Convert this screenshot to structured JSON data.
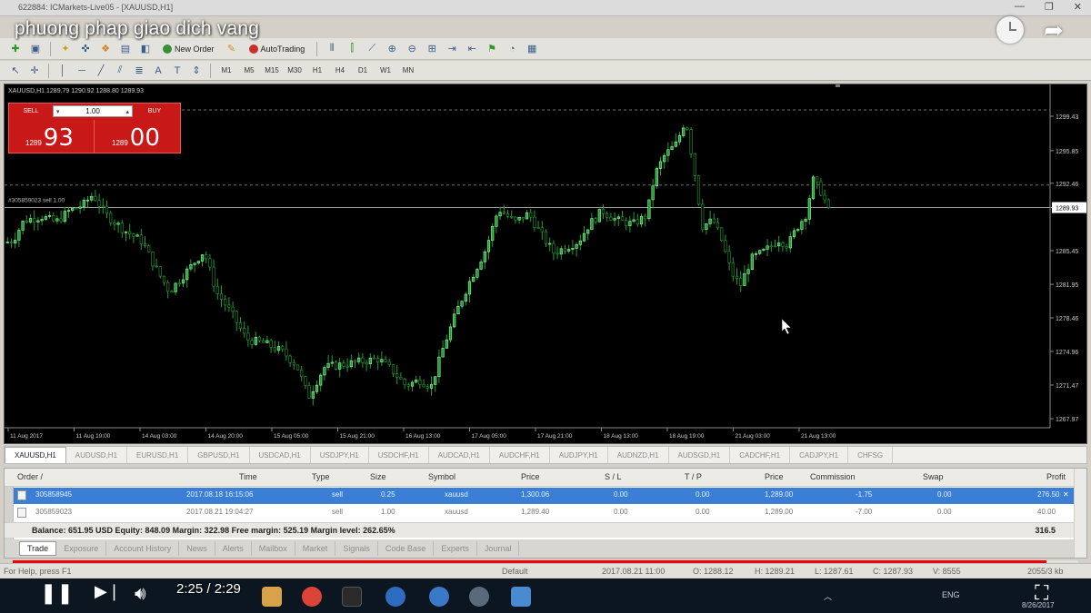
{
  "window": {
    "title": "622884: ICMarkets-Live05 - [XAUUSD,H1]",
    "controls": [
      "—",
      "❐",
      "✕"
    ]
  },
  "video": {
    "title": "phuong phap giao dich vang",
    "time": "2:25 / 2:29",
    "progress": 0.97
  },
  "toolbar": {
    "new_order_label": "New Order",
    "autotrading_label": "AutoTrading",
    "timeframes": [
      "M1",
      "M5",
      "M15",
      "M30",
      "H1",
      "H4",
      "D1",
      "W1",
      "MN"
    ]
  },
  "chart": {
    "header": "XAUUSD,H1  1289.79 1290.92 1288.80 1289.93",
    "order_line_label": "#305859023 sell 1.00",
    "current_price_label": "1289.93",
    "one_click": {
      "sell_label": "SELL",
      "buy_label": "BUY",
      "lot": "1.00",
      "sell_price_small": "1289",
      "sell_price_big": "93",
      "buy_price_small": "1289",
      "buy_price_big": "00"
    },
    "price_ticks": [
      "1299.43",
      "1295.85",
      "1292.46",
      "1289.93",
      "1285.45",
      "1281.95",
      "1278.46",
      "1274.96",
      "1271.47",
      "1267.97"
    ],
    "time_ticks": [
      "11 Aug 2017",
      "11 Aug 19:00",
      "14 Aug 03:00",
      "14 Aug 20:00",
      "15 Aug 05:00",
      "15 Aug 21:00",
      "16 Aug 13:00",
      "17 Aug 05:00",
      "17 Aug 21:00",
      "18 Aug 13:00",
      "18 Aug 19:00",
      "21 Aug 03:00",
      "21 Aug 13:00"
    ],
    "colors": {
      "background": "#000000",
      "candle": "#1f9e3a",
      "candle_light": "#9aff9a",
      "grid_dash": "#6f6f6f"
    }
  },
  "symbol_tabs": [
    "XAUUSD,H1",
    "AUDUSD,H1",
    "EURUSD,H1",
    "GBPUSD,H1",
    "USDCAD,H1",
    "USDJPY,H1",
    "USDCHF,H1",
    "AUDCAD,H1",
    "AUDCHF,H1",
    "AUDJPY,H1",
    "AUDNZD,H1",
    "AUDSGD,H1",
    "CADCHF,H1",
    "CADJPY,H1",
    "CHFSG"
  ],
  "terminal": {
    "columns": [
      "Order  /",
      "Time",
      "Type",
      "Size",
      "Symbol",
      "Price",
      "S / L",
      "T / P",
      "Price",
      "Commission",
      "Swap",
      "Profit"
    ],
    "rows": [
      {
        "order": "305858945",
        "time": "2017.08.18 16:15:06",
        "type": "sell",
        "size": "0.25",
        "symbol": "xauusd",
        "price": "1,300.06",
        "sl": "0.00",
        "tp": "0.00",
        "price2": "1,289.00",
        "commission": "-1.75",
        "swap": "0.00",
        "profit": "276.50",
        "selected": true
      },
      {
        "order": "305859023",
        "time": "2017.08.21 19:04:27",
        "type": "sell",
        "size": "1.00",
        "symbol": "xauusd",
        "price": "1,289.40",
        "sl": "0.00",
        "tp": "0.00",
        "price2": "1,289.00",
        "commission": "-7.00",
        "swap": "0.00",
        "profit": "40.00",
        "selected": false
      }
    ],
    "balance_line": "Balance: 651.95 USD  Equity: 848.09  Margin: 322.98  Free margin: 525.19  Margin level: 262.65%",
    "balance_total": "316.5",
    "tabs": [
      "Trade",
      "Exposure",
      "Account History",
      "News",
      "Alerts",
      "Mailbox",
      "Market",
      "Signals",
      "Code Base",
      "Experts",
      "Journal"
    ]
  },
  "statusbar": {
    "help": "For Help, press F1",
    "profile": "Default",
    "datetime": "2017.08.21 11:00",
    "open": "O: 1288.12",
    "high": "H: 1289.21",
    "low": "L: 1287.61",
    "close": "C: 1287.93",
    "volume": "V: 8555",
    "traffic": "2055/3 kb"
  },
  "taskbar": {
    "tray_lang": "ENG",
    "tray_date": "8/26/2017"
  }
}
